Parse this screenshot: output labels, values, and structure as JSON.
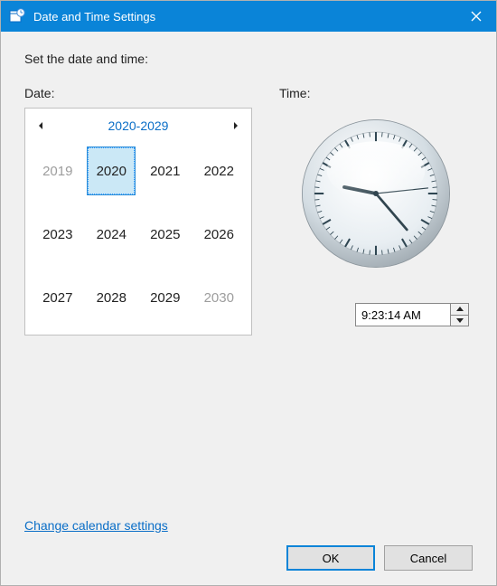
{
  "titlebar": {
    "title": "Date and Time Settings"
  },
  "instruction": "Set the date and time:",
  "date": {
    "label": "Date:",
    "decade_label": "2020-2029",
    "years": [
      {
        "v": "2019",
        "outside": true,
        "selected": false
      },
      {
        "v": "2020",
        "outside": false,
        "selected": true
      },
      {
        "v": "2021",
        "outside": false,
        "selected": false
      },
      {
        "v": "2022",
        "outside": false,
        "selected": false
      },
      {
        "v": "2023",
        "outside": false,
        "selected": false
      },
      {
        "v": "2024",
        "outside": false,
        "selected": false
      },
      {
        "v": "2025",
        "outside": false,
        "selected": false
      },
      {
        "v": "2026",
        "outside": false,
        "selected": false
      },
      {
        "v": "2027",
        "outside": false,
        "selected": false
      },
      {
        "v": "2028",
        "outside": false,
        "selected": false
      },
      {
        "v": "2029",
        "outside": false,
        "selected": false
      },
      {
        "v": "2030",
        "outside": true,
        "selected": false
      }
    ]
  },
  "time": {
    "label": "Time:",
    "value": " 9:23:14 AM",
    "hours": 9,
    "minutes": 23,
    "seconds": 14,
    "ampm": "AM"
  },
  "footer": {
    "link": "Change calendar settings",
    "ok": "OK",
    "cancel": "Cancel"
  },
  "icons": {
    "app": "datetime-icon",
    "close": "close-icon",
    "prev": "chevron-left-icon",
    "next": "chevron-right-icon",
    "up": "chevron-up-icon",
    "down": "chevron-down-icon"
  }
}
